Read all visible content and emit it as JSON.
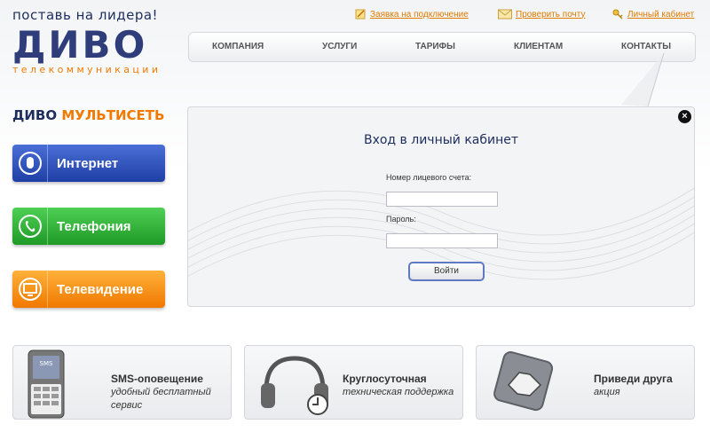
{
  "brand": {
    "slogan": "поставь на лидера!",
    "logo": "ДИВО",
    "subtitle": "телекоммуникации"
  },
  "top_links": {
    "request": "Заявка на подключение",
    "check_mail": "Проверить почту",
    "cabinet": "Личный кабинет"
  },
  "nav": {
    "items": [
      "КОМПАНИЯ",
      "УСЛУГИ",
      "ТАРИФЫ",
      "КЛИЕНТАМ",
      "КОНТАКТЫ"
    ]
  },
  "services": {
    "title_a": "ДИВО",
    "title_b": "МУЛЬТИСЕТЬ",
    "internet": "Интернет",
    "telephony": "Телефония",
    "tv": "Телевидение"
  },
  "login": {
    "title": "Вход в личный кабинет",
    "account_label": "Номер лицевого счета:",
    "account_value": "",
    "password_label": "Пароль:",
    "password_value": "",
    "submit": "Войти"
  },
  "promos": {
    "sms_title": "SMS-оповещение",
    "sms_sub": "удобный бесплатный сервис",
    "sms_phone_text": "SMS",
    "support_title": "Круглосуточная",
    "support_sub": "техническая поддержка",
    "friend_title": "Приведи друга",
    "friend_sub": "акция"
  },
  "colors": {
    "brand_blue": "#2f3e7a",
    "brand_orange": "#f07a00",
    "internet": "#2d4fc0",
    "telephony": "#2bb234",
    "tv": "#f58a10"
  }
}
